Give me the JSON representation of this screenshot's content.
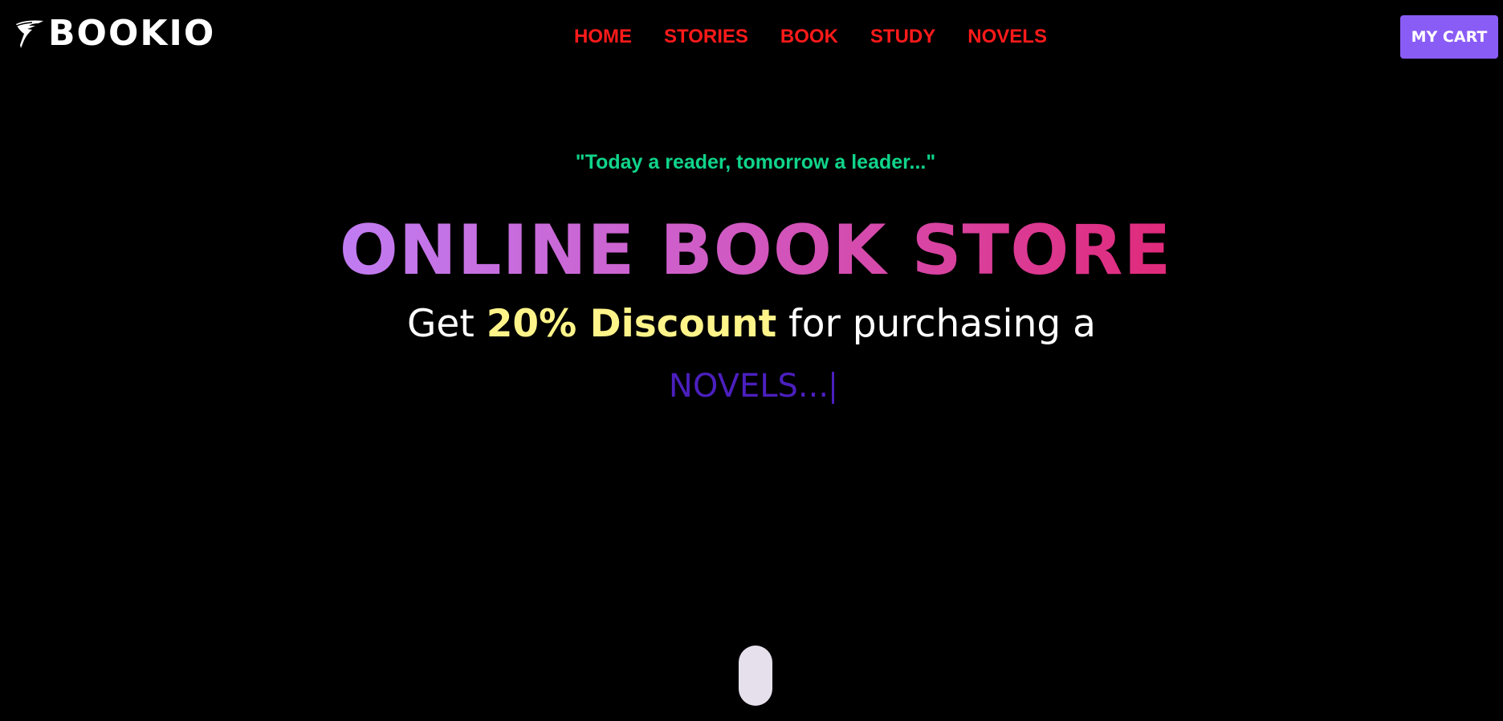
{
  "header": {
    "logo_text": "BOOKIO",
    "logo_icon": "quill-pen-icon",
    "nav": [
      {
        "label": "HOME"
      },
      {
        "label": "STORIES"
      },
      {
        "label": "BOOK"
      },
      {
        "label": "STUDY"
      },
      {
        "label": "NOVELS"
      }
    ],
    "cart_label": "MY CART"
  },
  "hero": {
    "quote": "\"Today a reader, tomorrow a leader...\"",
    "headline": "ONLINE BOOK STORE",
    "offer_prefix": "Get ",
    "offer_highlight": "20% Discount",
    "offer_suffix": " for purchasing a",
    "typed_text": "NOVELS..."
  },
  "scroll_indicator_icon": "mouse-scroll-icon",
  "colors": {
    "background": "#000000",
    "nav_link": "#ff1a1a",
    "cart_button": "#8a5cf6",
    "quote": "#10d48a",
    "headline_gradient_start": "#c07cf2",
    "headline_gradient_end": "#e0297a",
    "offer_highlight": "#fff48a",
    "typed_text": "#4b1fbf"
  }
}
